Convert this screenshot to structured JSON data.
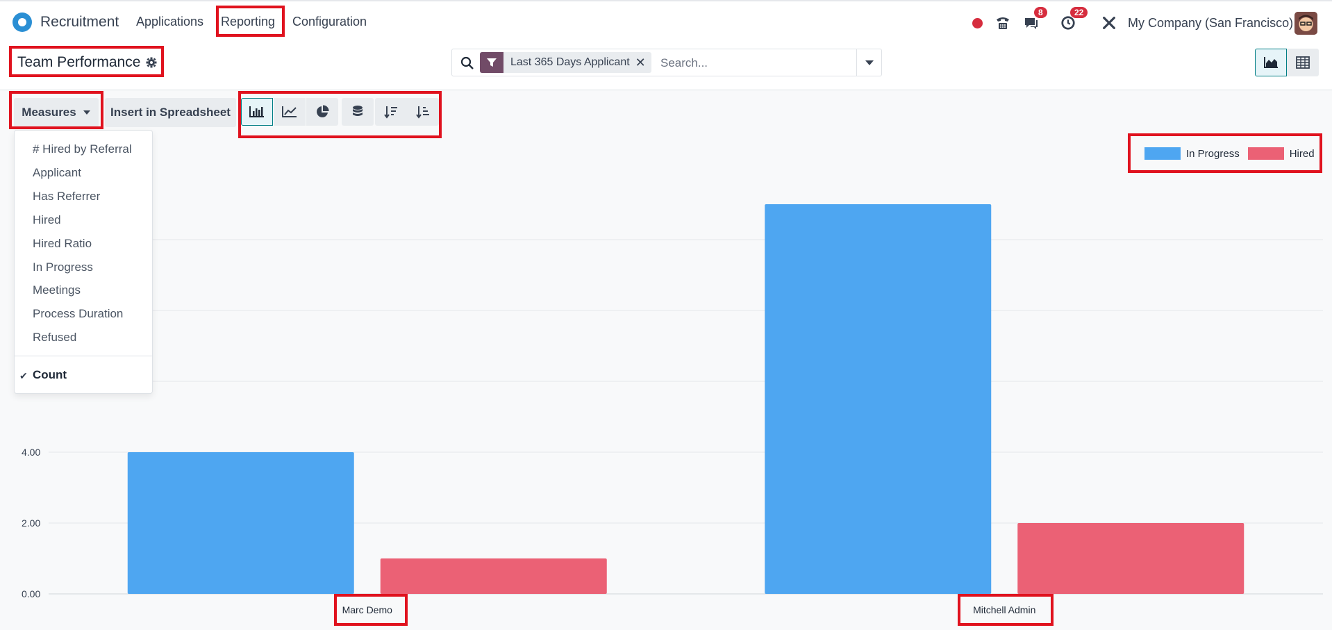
{
  "navbar": {
    "app_name": "Recruitment",
    "menu": [
      "Applications",
      "Reporting",
      "Configuration"
    ],
    "messages_badge": "8",
    "activities_badge": "22",
    "company": "My Company (San Francisco)"
  },
  "control_panel": {
    "page_title": "Team Performance",
    "facet_label": "Last 365 Days Applicant",
    "search_placeholder": "Search..."
  },
  "toolbar": {
    "measures_label": "Measures",
    "insert_label": "Insert in Spreadsheet",
    "chart_buttons": [
      "bar-chart-icon",
      "line-chart-icon",
      "pie-chart-icon",
      "stacked-icon",
      "sort-descending-icon",
      "sort-ascending-icon"
    ]
  },
  "measures_menu": {
    "items": [
      "# Hired by Referral",
      "Applicant",
      "Has Referrer",
      "Hired",
      "Hired Ratio",
      "In Progress",
      "Meetings",
      "Process Duration",
      "Refused"
    ],
    "checked_item": "Count"
  },
  "chart_data": {
    "type": "bar",
    "categories": [
      "Marc Demo",
      "Mitchell Admin"
    ],
    "series": [
      {
        "name": "In Progress",
        "values": [
          4,
          11
        ],
        "color": "#4ea6f1"
      },
      {
        "name": "Hired",
        "values": [
          1,
          2
        ],
        "color": "#eb6175"
      }
    ],
    "y_ticks": [
      "4.00",
      "2.00",
      "0.00"
    ],
    "ylim": [
      0,
      12
    ],
    "grid": true,
    "legend_position": "top-right"
  }
}
